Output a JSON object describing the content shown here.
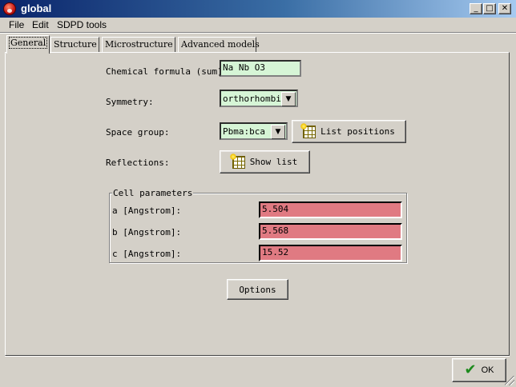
{
  "window": {
    "title": "global",
    "controls": {
      "minimize_glyph": "_",
      "maximize_glyph": "□",
      "close_glyph": "✕"
    },
    "app_icon": "app-icon",
    "accent_color": "#0a246a"
  },
  "menu": {
    "items": [
      {
        "label": "File"
      },
      {
        "label": "Edit"
      },
      {
        "label": "SDPD tools"
      }
    ]
  },
  "tabs": [
    {
      "label": "General",
      "active": true
    },
    {
      "label": "Structure",
      "active": false
    },
    {
      "label": "Microstructure",
      "active": false
    },
    {
      "label": "Advanced models",
      "active": false
    }
  ],
  "general": {
    "chemical_formula": {
      "label": "Chemical formula (sum):",
      "value": "Na Nb O3"
    },
    "symmetry": {
      "label": "Symmetry:",
      "value": "orthorhombic"
    },
    "space_group": {
      "label": "Space group:",
      "value": "Pbma:bca"
    },
    "list_positions_label": "List positions",
    "reflections": {
      "label": "Reflections:",
      "button_label": "Show list"
    },
    "cell_parameters": {
      "title": "Cell parameters",
      "rows": [
        {
          "label": "a [Angstrom]:",
          "value": "5.504"
        },
        {
          "label": "b [Angstrom]:",
          "value": "5.568"
        },
        {
          "label": "c [Angstrom]:",
          "value": "15.52"
        }
      ]
    },
    "options_label": "Options"
  },
  "footer": {
    "ok_label": "OK"
  },
  "colors": {
    "input_green": "#d6f5d6",
    "input_red": "#e07a82",
    "window_bg": "#d4d0c8"
  }
}
